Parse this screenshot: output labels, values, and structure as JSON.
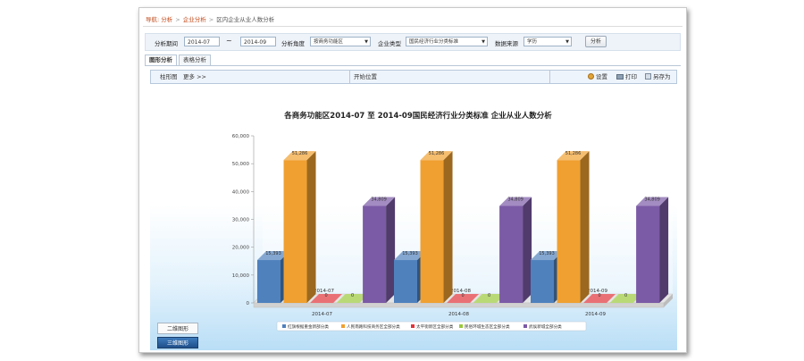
{
  "breadcrumb": {
    "items": [
      "导航:",
      "分析",
      "企业分析",
      "区内企业从业人数分析"
    ]
  },
  "filters": {
    "period_label": "分析期间",
    "start_value": "2014-07",
    "tilde": "~",
    "end_value": "2014-09",
    "angle_label": "分析角度",
    "angle_value": "按商务功能区",
    "type_label": "企业类型",
    "type_value": "国民经济行业分类标准",
    "source_label": "数据来源",
    "source_value": "学历",
    "analyze_button": "分析"
  },
  "tabs": [
    {
      "label": "图形分析",
      "active": true
    },
    {
      "label": "表格分析",
      "active": false
    }
  ],
  "chart_toolbar": {
    "chart_type": "柱形图",
    "more": "更多 >>",
    "position": "开始位置",
    "settings": "设置",
    "print": "打印",
    "save_as": "另存为"
  },
  "chart_mode": {
    "two_d": "二维图形",
    "three_d": "三维图形"
  },
  "chart_data": {
    "type": "bar",
    "title": "各商务功能区2014-07 至 2014-09国民经济行业分类标准 企业从业人数分析",
    "categories": [
      "2014-07",
      "2014-08",
      "2014-09"
    ],
    "series": [
      {
        "name": "红旗根据重金新部分类",
        "color": "#4f81bd",
        "values": [
          15393,
          15393,
          15393
        ]
      },
      {
        "name": "人民南路科技商务区全部分类",
        "color": "#f0a030",
        "values": [
          51286,
          51286,
          51286
        ]
      },
      {
        "name": "太平街新区全部分类",
        "color": "#e0343a",
        "values": [
          0,
          0,
          0
        ]
      },
      {
        "name": "民俗环城生态区全部分类",
        "color": "#9bc83c",
        "values": [
          0,
          0,
          0
        ]
      },
      {
        "name": "武侯新城全部分类",
        "color": "#7b5aa6",
        "values": [
          34809,
          34809,
          34809
        ]
      }
    ],
    "value_labels": [
      "15,393",
      "51,286",
      "0",
      "0",
      "34,809"
    ],
    "y_ticks": [
      "0",
      "10,000",
      "20,000",
      "30,000",
      "40,000",
      "50,000",
      "60,000"
    ],
    "ylim": [
      0,
      60000
    ],
    "grid": false,
    "legend_position": "bottom"
  }
}
